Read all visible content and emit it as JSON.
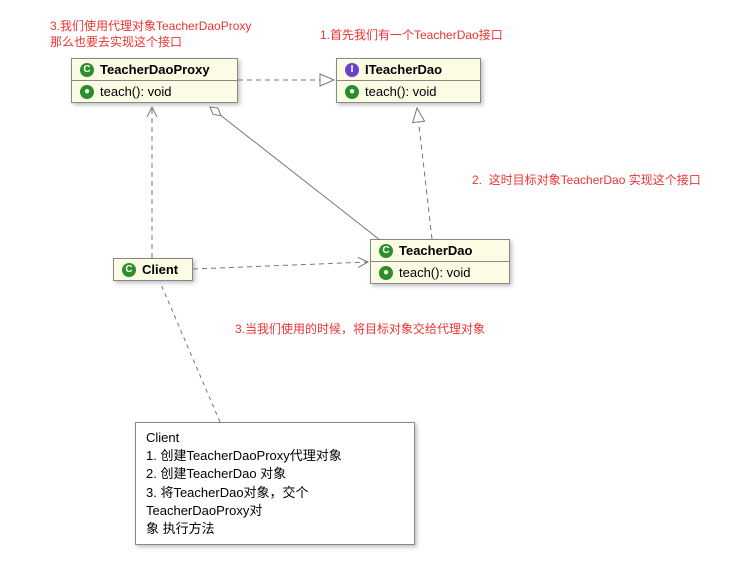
{
  "annotations": {
    "a1": "1.首先我们有一个TeacherDao接口",
    "a2": "2.  这时目标对象TeacherDao 实现这个接口",
    "a3_l1": "3.我们使用代理对象TeacherDaoProxy",
    "a3_l2": "那么也要去实现这个接口",
    "a4": "3.当我们使用的时候，将目标对象交给代理对象"
  },
  "classes": {
    "proxy": {
      "name": "TeacherDaoProxy",
      "method": "teach(): void",
      "badge": "C"
    },
    "iface": {
      "name": "ITeacherDao",
      "method": "teach(): void",
      "badge": "I"
    },
    "dao": {
      "name": "TeacherDao",
      "method": "teach(): void",
      "badge": "C"
    },
    "client": {
      "name": "Client",
      "badge": "C"
    }
  },
  "note": {
    "title": "Client",
    "line1": "1. 创建TeacherDaoProxy代理对象",
    "line2": "2. 创建TeacherDao 对象",
    "line3": "3. 将TeacherDao对象，交个TeacherDaoProxy对",
    "line4": "象 执行方法"
  },
  "method_badge": "●"
}
